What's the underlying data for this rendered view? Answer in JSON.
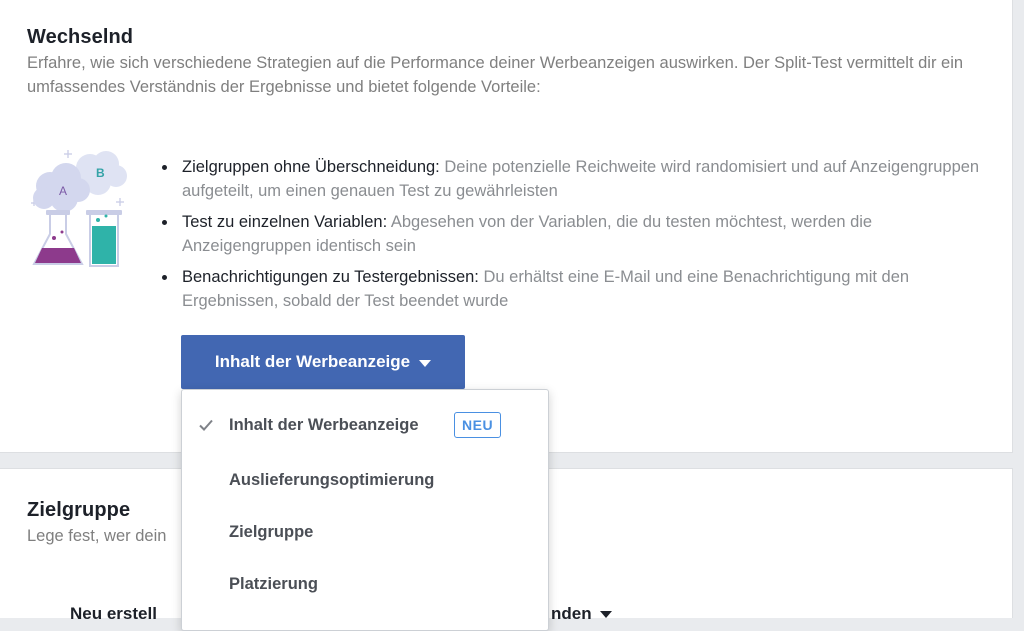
{
  "split_test": {
    "title": "Wechselnd",
    "description": "Erfahre, wie sich verschiedene Strategien auf die Performance deiner Werbeanzeigen auswirken. Der Split-Test vermittelt dir ein umfassendes Verständnis der Ergebnisse und bietet folgende Vorteile:",
    "benefits": [
      {
        "title": "Zielgruppen ohne Überschneidung:",
        "text": "Deine potenzielle Reichweite wird randomisiert und auf Anzeigengruppen aufgeteilt, um einen genauen Test zu gewährleisten"
      },
      {
        "title": "Test zu einzelnen Variablen:",
        "text": "Abgesehen von der Variablen, die du testen möchtest, werden die Anzeigengruppen identisch sein"
      },
      {
        "title": "Benachrichtigungen zu Testergebnissen:",
        "text": "Du erhältst eine E-Mail und eine Benachrichtigung mit den Ergebnissen, sobald der Test beendet wurde"
      }
    ],
    "illustration": {
      "label_a": "A",
      "label_b": "B"
    },
    "variable_button_label": "Inhalt der Werbeanzeige",
    "dropdown": {
      "items": [
        {
          "label": "Inhalt der Werbeanzeige",
          "selected": true,
          "badge": "NEU"
        },
        {
          "label": "Auslieferungsoptimierung",
          "selected": false
        },
        {
          "label": "Zielgruppe",
          "selected": false
        },
        {
          "label": "Platzierung",
          "selected": false
        }
      ]
    }
  },
  "audience": {
    "title": "Zielgruppe",
    "description": "Lege fest, wer dein",
    "partial_left": "Neu erstell",
    "partial_right": "nden"
  },
  "colors": {
    "primary": "#4267b2",
    "badge": "#4a90e2",
    "muted_text": "#8a8d91",
    "background": "#e9ebee"
  }
}
